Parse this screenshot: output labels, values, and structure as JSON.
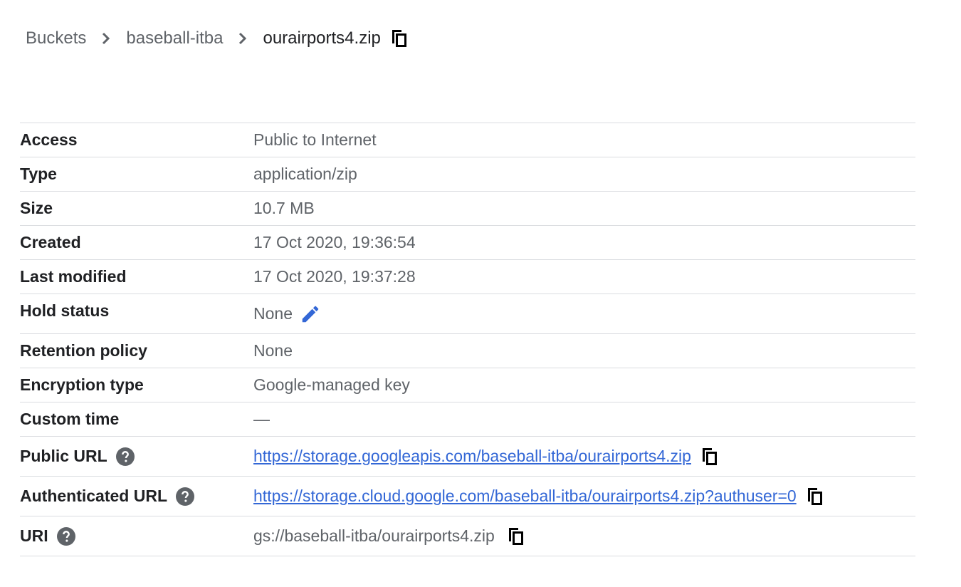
{
  "breadcrumb": {
    "items": [
      "Buckets",
      "baseball-itba"
    ],
    "current": "ourairports4.zip"
  },
  "icons": {
    "separator": "chevron-right-icon",
    "copy": "copy-icon",
    "help": "help-icon",
    "edit": "pencil-icon"
  },
  "colors": {
    "link": "#3367d6",
    "label": "#202124",
    "value": "#5f6368",
    "divider": "#dadce0"
  },
  "details": {
    "access": {
      "label": "Access",
      "value": "Public to Internet"
    },
    "type": {
      "label": "Type",
      "value": "application/zip"
    },
    "size": {
      "label": "Size",
      "value": "10.7 MB"
    },
    "created": {
      "label": "Created",
      "value": "17 Oct 2020, 19:36:54"
    },
    "last_modified": {
      "label": "Last modified",
      "value": "17 Oct 2020, 19:37:28"
    },
    "hold_status": {
      "label": "Hold status",
      "value": "None"
    },
    "retention_policy": {
      "label": "Retention policy",
      "value": "None"
    },
    "encryption_type": {
      "label": "Encryption type",
      "value": "Google-managed key"
    },
    "custom_time": {
      "label": "Custom time",
      "value": "—"
    },
    "public_url": {
      "label": "Public URL",
      "value": "https://storage.googleapis.com/baseball-itba/ourairports4.zip"
    },
    "authenticated_url": {
      "label": "Authenticated URL",
      "value": "https://storage.cloud.google.com/baseball-itba/ourairports4.zip?authuser=0"
    },
    "uri": {
      "label": "URI",
      "value": "gs://baseball-itba/ourairports4.zip"
    }
  }
}
